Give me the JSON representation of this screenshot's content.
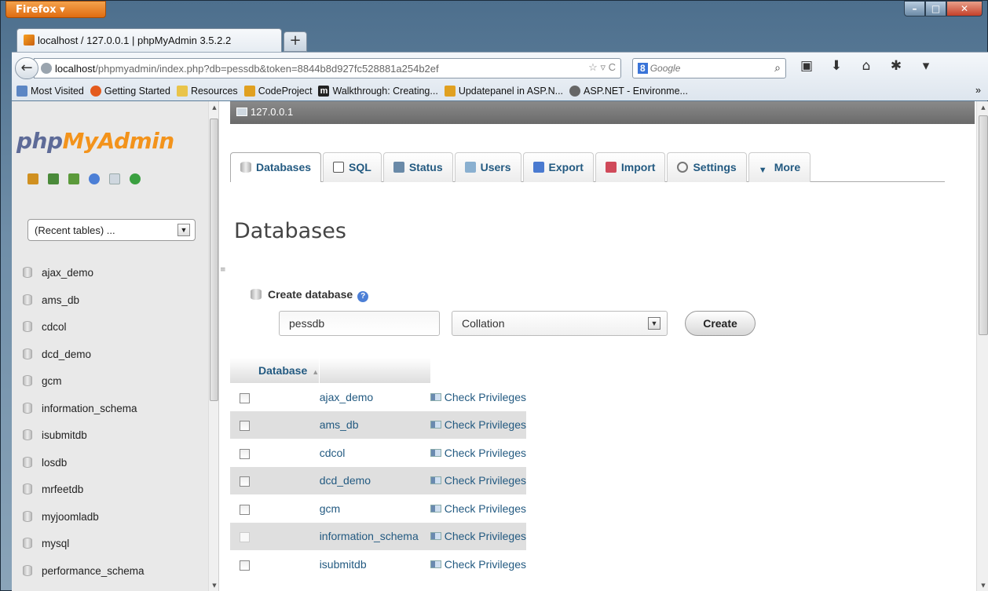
{
  "browser": {
    "menu_label": "Firefox ▾",
    "tab_title": "localhost / 127.0.0.1 | phpMyAdmin 3.5.2.2",
    "newtab_label": "+",
    "url_host": "localhost",
    "url_rest": "/phpmyadmin/index.php?db=pessdb&token=8844b8d927fc528881a254b2ef",
    "search_engine_badge": "8",
    "search_placeholder": "Google",
    "bookmarks": [
      {
        "label": "Most Visited",
        "icon": "most-visited-icon"
      },
      {
        "label": "Getting Started",
        "icon": "firefox-icon"
      },
      {
        "label": "Resources",
        "icon": "folder-icon"
      },
      {
        "label": "CodeProject",
        "icon": "codeproject-icon"
      },
      {
        "label": "Walkthrough: Creating...",
        "icon": "msdn-icon"
      },
      {
        "label": "Updatepanel in ASP.N...",
        "icon": "codeproject-icon"
      },
      {
        "label": "ASP.NET - Environme...",
        "icon": "aspnet-icon"
      }
    ],
    "bookmarks_overflow": "»"
  },
  "sidebar": {
    "logo_php": "php",
    "logo_myadmin": "MyAdmin",
    "recent_tables": "(Recent tables) ...",
    "databases": [
      "ajax_demo",
      "ams_db",
      "cdcol",
      "dcd_demo",
      "gcm",
      "information_schema",
      "isubmitdb",
      "losdb",
      "mrfeetdb",
      "myjoomladb",
      "mysql",
      "performance_schema"
    ]
  },
  "main": {
    "server": "127.0.0.1",
    "tabs": [
      {
        "label": "Databases",
        "icon": "database-icon"
      },
      {
        "label": "SQL",
        "icon": "sql-icon"
      },
      {
        "label": "Status",
        "icon": "status-icon"
      },
      {
        "label": "Users",
        "icon": "users-icon"
      },
      {
        "label": "Export",
        "icon": "export-icon"
      },
      {
        "label": "Import",
        "icon": "import-icon"
      },
      {
        "label": "Settings",
        "icon": "settings-icon"
      },
      {
        "label": "More",
        "icon": "more-arrow-icon"
      }
    ],
    "title": "Databases",
    "create_label": "Create database",
    "db_name_value": "pessdb",
    "collation_value": "Collation",
    "create_button": "Create",
    "table_header_db": "Database",
    "table_header_sort": "▲",
    "privileges_label": "Check Privileges",
    "rows": [
      {
        "name": "ajax_demo",
        "checkbox_enabled": true
      },
      {
        "name": "ams_db",
        "checkbox_enabled": true
      },
      {
        "name": "cdcol",
        "checkbox_enabled": true
      },
      {
        "name": "dcd_demo",
        "checkbox_enabled": true
      },
      {
        "name": "gcm",
        "checkbox_enabled": true
      },
      {
        "name": "information_schema",
        "checkbox_enabled": false
      },
      {
        "name": "isubmitdb",
        "checkbox_enabled": true
      }
    ]
  },
  "colors": {
    "link": "#235a81",
    "logo_php": "#5e6b98",
    "logo_myadmin": "#f3931b"
  }
}
